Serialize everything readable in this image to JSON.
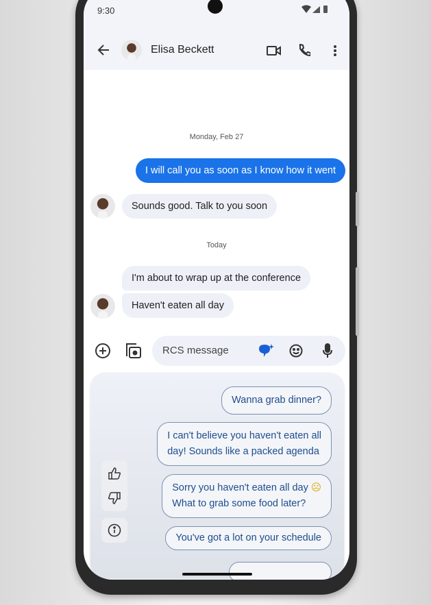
{
  "status": {
    "time": "9:30"
  },
  "header": {
    "contact_name": "Elisa Beckett"
  },
  "messages": [
    {
      "type": "date",
      "text": "Monday, Feb 27"
    },
    {
      "type": "outgoing",
      "text": "I will call you as soon as I know how it went"
    },
    {
      "type": "incoming",
      "text": "Sounds good. Talk to you soon"
    },
    {
      "type": "date",
      "text": "Today"
    },
    {
      "type": "incoming",
      "text": "I'm about to wrap up at the conference"
    },
    {
      "type": "incoming",
      "text": "Haven't eaten all day"
    }
  ],
  "compose": {
    "placeholder": "RCS message"
  },
  "suggestions": [
    {
      "line1": "Wanna grab dinner?",
      "line2": ""
    },
    {
      "line1": "I can't believe you haven't eaten all",
      "line2": "day! Sounds like a packed agenda"
    },
    {
      "line1": "Sorry you haven't eaten all day",
      "line2": "What to grab some food later?",
      "emoji": "☹"
    },
    {
      "line1": "You've got a lot on your schedule",
      "line2": ""
    }
  ],
  "colors": {
    "accent": "#1a73e8",
    "chip_text": "#1f4d8c"
  }
}
